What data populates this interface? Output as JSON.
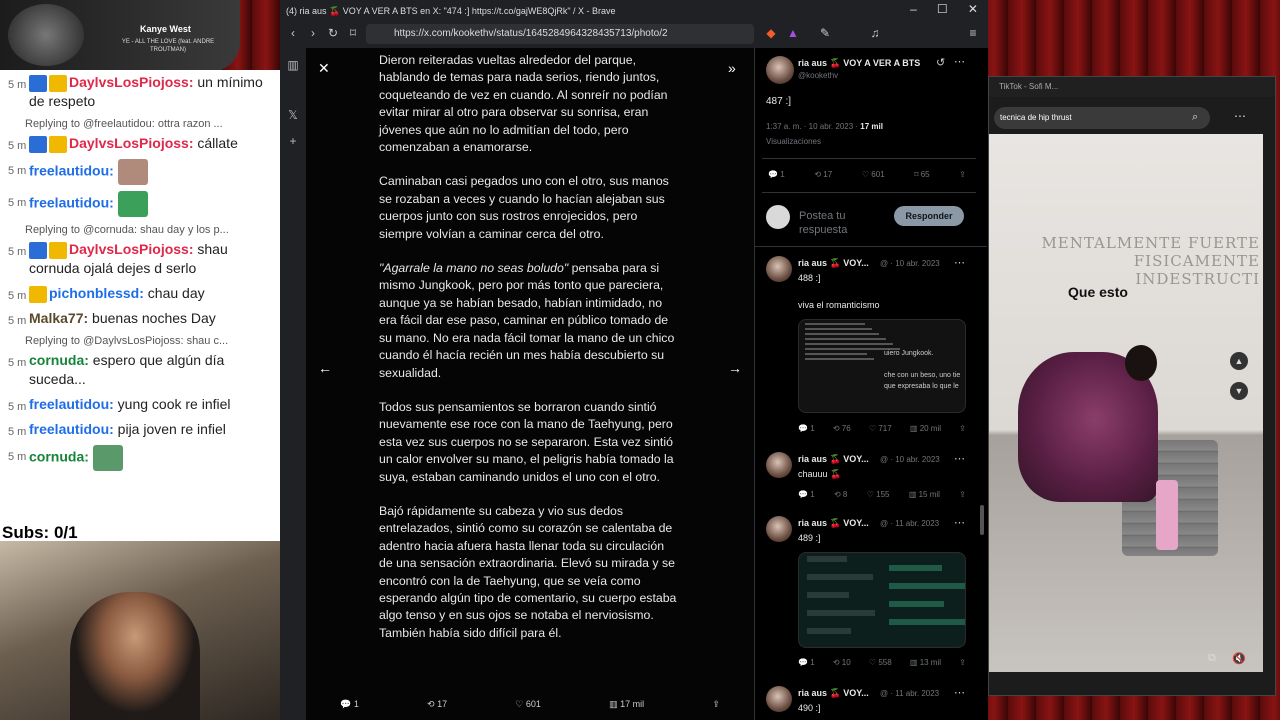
{
  "now_playing": {
    "artist": "Kanye West",
    "song": "YE - ALL THE LOVE (feat. ANDRE TROUTMAN)"
  },
  "chat": {
    "messages": [
      {
        "ts": "5 m",
        "user": "DaylvsLosPiojoss:",
        "text": "un mínimo de respeto",
        "color": "red",
        "badges": true
      },
      {
        "reply": "Replying to @freelautidou: ottra razon ...",
        "ts": "5 m",
        "user": "DaylvsLosPiojoss:",
        "text": "cállate",
        "color": "red",
        "badges": true
      },
      {
        "ts": "5 m",
        "user": "freelautidou:",
        "text": "",
        "color": "blue",
        "emote": "#b08a7a"
      },
      {
        "ts": "5 m",
        "user": "freelautidou:",
        "text": "",
        "color": "blue",
        "emote": "#3aa05a"
      },
      {
        "reply": "Replying to @cornuda: shau day y los p...",
        "ts": "5 m",
        "user": "DaylvsLosPiojoss:",
        "text": "shau cornuda ojalá dejes d serlo",
        "color": "red",
        "badges": true
      },
      {
        "ts": "5 m",
        "user": "pichonblessd:",
        "text": "chau day",
        "color": "blue",
        "crown": true
      },
      {
        "ts": "5 m",
        "user": "Malka77:",
        "text": "buenas noches Day",
        "color": "tan"
      },
      {
        "reply": "Replying to @DaylvsLosPiojoss: shau c...",
        "ts": "5 m",
        "user": "cornuda:",
        "text": "espero que algún día suceda...",
        "color": "green"
      },
      {
        "ts": "5 m",
        "user": "freelautidou:",
        "text": "yung cook re infiel",
        "color": "blue"
      },
      {
        "ts": "5 m",
        "user": "freelautidou:",
        "text": "pija joven re infiel",
        "color": "blue"
      },
      {
        "ts": "5 m",
        "user": "cornuda:",
        "text": "",
        "color": "green",
        "emote": "#5a9a6a"
      }
    ],
    "subs": "Subs: 0/1"
  },
  "browser": {
    "title": "(4) ria aus 🍒 VOY A VER A BTS en X: \"474 :] https://t.co/gajWE8QjRk\" / X - Brave",
    "url": "https://x.com/kookethv/status/1645284964328435713/photo/2",
    "controls": [
      "–",
      "☐",
      "✕"
    ]
  },
  "story": {
    "paragraphs": [
      "Dieron reiteradas vueltas alrededor del parque, hablando de temas para nada serios, riendo juntos, coqueteando de vez en cuando. Al sonreír no podían evitar mirar al otro para observar su sonrisa, eran jóvenes que aún no lo admitían del todo, pero comenzaban a enamorarse.",
      "Caminaban casi pegados uno con el otro, sus manos se rozaban a veces y cuando lo hacían alejaban sus cuerpos junto con sus rostros enrojecidos, pero siempre volvían a caminar cerca del otro.",
      "\"Agarrale la mano no seas boludo\" pensaba para si mismo Jungkook, pero por más tonto que pareciera, aunque ya se habían besado, habían intimidado, no era fácil dar ese paso, caminar en público tomado de su mano. No era nada fácil tomar la mano de un chico cuando él hacía recién un mes había descubierto su sexualidad.",
      "Todos sus pensamientos se borraron cuando sintió nuevamente ese roce con la mano de Taehyung, pero esta vez sus cuerpos no se separaron. Esta vez sintió un calor envolver su mano, el peligris había tomado la suya, estaban caminando unidos el uno con el otro.",
      "Bajó rápidamente su cabeza y vio sus dedos entrelazados, sintió como su corazón se calentaba de adentro hacia afuera hasta llenar toda su circulación de una sensación extraordinaria. Elevó su mirada y se encontró con la de Taehyung, que se veía como esperando algún tipo de comentario, su cuerpo estaba algo tenso y en sus ojos se notaba el nerviosismo. También había sido difícil para él."
    ],
    "quote": "\"Agarrale la mano no seas boludo\"",
    "stats": {
      "replies": "1",
      "retweets": "17",
      "likes": "601",
      "views": "17 mil"
    }
  },
  "tweet": {
    "name": "ria aus 🍒 VOY A VER A BTS",
    "handle": "@kookethv",
    "text": "487 :]",
    "time": "1:37 a. m. · 10 abr. 2023 · ",
    "views_num": "17 mil",
    "views_label": "Visualizaciones",
    "stats": {
      "replies": "1",
      "retweets": "17",
      "likes": "601",
      "bookmarks": "65"
    },
    "reply_placeholder": "Postea tu respuesta",
    "reply_button": "Responder"
  },
  "replies": [
    {
      "name": "ria aus 🍒 VOY...",
      "meta": "@ · 10 abr. 2023",
      "text": "488 :]",
      "extra": "viva el romanticismo",
      "shot": "story",
      "snippet1": "uiero Jungkook.",
      "snippet2": "che con un beso, uno tie",
      "snippet3": "que expresaba lo que le",
      "stats": [
        "1",
        "76",
        "717",
        "20 mil"
      ]
    },
    {
      "name": "ria aus 🍒 VOY...",
      "meta": "@ · 10 abr. 2023",
      "text": "chauuu 🍒",
      "stats": [
        "1",
        "8",
        "155",
        "15 mil"
      ]
    },
    {
      "name": "ria aus 🍒 VOY...",
      "meta": "@ · 11 abr. 2023",
      "text": "489 :]",
      "shot": "chat",
      "stats": [
        "1",
        "10",
        "558",
        "13 mil"
      ]
    },
    {
      "name": "ria aus 🍒 VOY...",
      "meta": "@ · 11 abr. 2023",
      "text": "490 :]"
    }
  ],
  "tiktok": {
    "title": "TikTok - Sofi M...",
    "search": "tecnica de hip thrust",
    "wall_text": "MENTALMENTE FUERTE\nFISICAMENTE INDESTRUCTI",
    "caption": "Que esto"
  }
}
